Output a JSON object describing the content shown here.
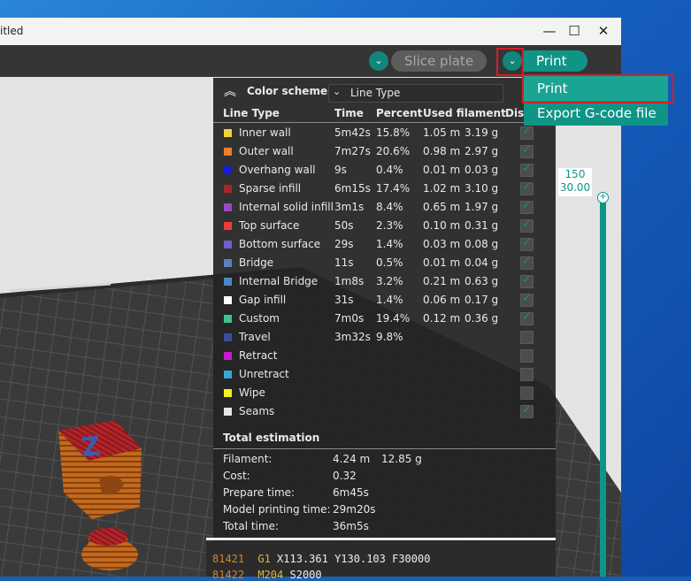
{
  "window": {
    "title": "itled",
    "controls": {
      "minimize": "—",
      "maximize": "☐",
      "close": "✕"
    }
  },
  "toolbar": {
    "slice_label": "Slice plate",
    "print_label": "Print",
    "dropdown_glyph": "⌄"
  },
  "print_menu": {
    "items": [
      "Print",
      "Export G-code file"
    ]
  },
  "panel": {
    "color_scheme_label": "Color scheme",
    "color_scheme_value": "Line Type",
    "columns": [
      "Line Type",
      "Time",
      "Percent",
      "Used filament",
      "Disp"
    ],
    "rows": [
      {
        "name": "Inner wall",
        "color": "#f2d23b",
        "time": "5m42s",
        "percent": "15.8%",
        "len": "1.05 m",
        "weight": "3.19 g",
        "checked": true
      },
      {
        "name": "Outer wall",
        "color": "#f07f2a",
        "time": "7m27s",
        "percent": "20.6%",
        "len": "0.98 m",
        "weight": "2.97 g",
        "checked": true
      },
      {
        "name": "Overhang wall",
        "color": "#1b1bd9",
        "time": "9s",
        "percent": "0.4%",
        "len": "0.01 m",
        "weight": "0.03 g",
        "checked": true
      },
      {
        "name": "Sparse infill",
        "color": "#a5282c",
        "time": "6m15s",
        "percent": "17.4%",
        "len": "1.02 m",
        "weight": "3.10 g",
        "checked": true
      },
      {
        "name": "Internal solid infill",
        "color": "#9b48c4",
        "time": "3m1s",
        "percent": "8.4%",
        "len": "0.65 m",
        "weight": "1.97 g",
        "checked": true
      },
      {
        "name": "Top surface",
        "color": "#ef3b3b",
        "time": "50s",
        "percent": "2.3%",
        "len": "0.10 m",
        "weight": "0.31 g",
        "checked": true
      },
      {
        "name": "Bottom surface",
        "color": "#6a60cf",
        "time": "29s",
        "percent": "1.4%",
        "len": "0.03 m",
        "weight": "0.08 g",
        "checked": true
      },
      {
        "name": "Bridge",
        "color": "#5f7fc1",
        "time": "11s",
        "percent": "0.5%",
        "len": "0.01 m",
        "weight": "0.04 g",
        "checked": true
      },
      {
        "name": "Internal Bridge",
        "color": "#4c86c8",
        "time": "1m8s",
        "percent": "3.2%",
        "len": "0.21 m",
        "weight": "0.63 g",
        "checked": true
      },
      {
        "name": "Gap infill",
        "color": "#ffffff",
        "time": "31s",
        "percent": "1.4%",
        "len": "0.06 m",
        "weight": "0.17 g",
        "checked": true
      },
      {
        "name": "Custom",
        "color": "#3fc38a",
        "time": "7m0s",
        "percent": "19.4%",
        "len": "0.12 m",
        "weight": "0.36 g",
        "checked": true
      },
      {
        "name": "Travel",
        "color": "#3a4e9c",
        "time": "3m32s",
        "percent": "9.8%",
        "len": "",
        "weight": "",
        "checked": false
      },
      {
        "name": "Retract",
        "color": "#c51bd3",
        "time": "",
        "percent": "",
        "len": "",
        "weight": "",
        "checked": false
      },
      {
        "name": "Unretract",
        "color": "#3aa7d8",
        "time": "",
        "percent": "",
        "len": "",
        "weight": "",
        "checked": false
      },
      {
        "name": "Wipe",
        "color": "#f2f21a",
        "time": "",
        "percent": "",
        "len": "",
        "weight": "",
        "checked": false
      },
      {
        "name": "Seams",
        "color": "#e6e6e6",
        "time": "",
        "percent": "",
        "len": "",
        "weight": "",
        "checked": true
      }
    ],
    "estimation_title": "Total estimation",
    "estimation": [
      {
        "label": "Filament:",
        "value": "4.24 m",
        "extra": "12.85 g"
      },
      {
        "label": "Cost:",
        "value": "0.32",
        "extra": ""
      },
      {
        "label": "Prepare time:",
        "value": "6m45s",
        "extra": ""
      },
      {
        "label": "Model printing time:",
        "value": "29m20s",
        "extra": ""
      },
      {
        "label": "Total time:",
        "value": "36m5s",
        "extra": ""
      }
    ]
  },
  "layer_slider": {
    "top_layer": "150",
    "top_height": "30.00",
    "knob_glyph": "+"
  },
  "gcode": [
    {
      "line": "81421",
      "cmd": "G1",
      "args": "X113.361 Y130.103 F30000"
    },
    {
      "line": "81422",
      "cmd": "M204",
      "args": "S2000"
    }
  ],
  "colors": {
    "accent": "#0f9585",
    "panel_bg": "#242424",
    "highlight": "#d21f2b"
  }
}
